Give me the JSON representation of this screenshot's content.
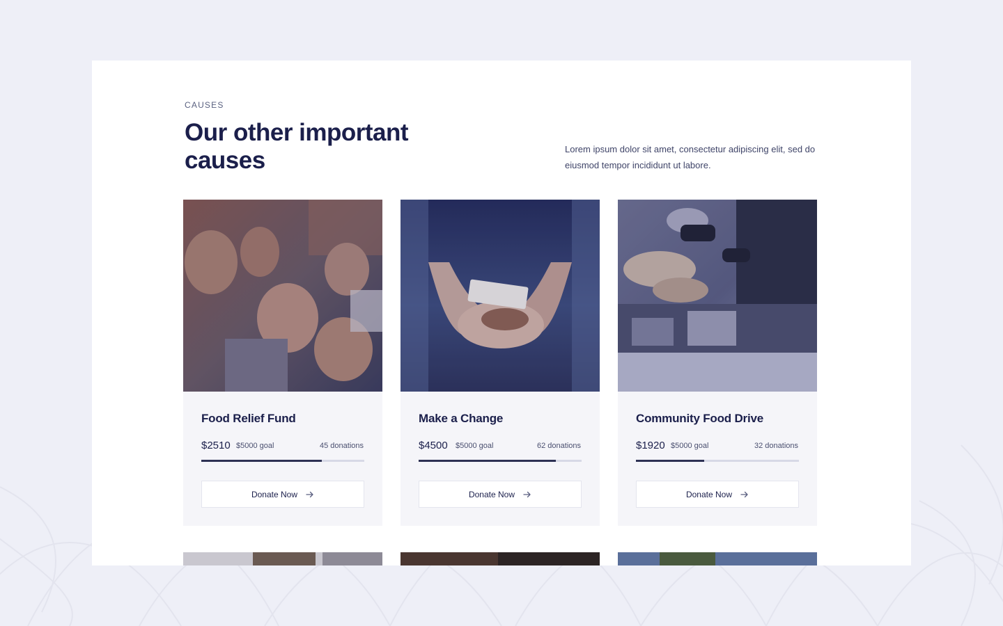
{
  "section": {
    "eyebrow": "CAUSES",
    "title": "Our other important causes",
    "description": "Lorem ipsum dolor sit amet, consectetur adipiscing elit, sed do eiusmod tempor incididunt ut labore."
  },
  "causes": [
    {
      "title": "Food Relief Fund",
      "raised": "$2510",
      "goal": "$5000 goal",
      "donations": "45 donations",
      "progress_fraction": 0.74,
      "button_label": "Donate Now",
      "image": "children-smiling-photo"
    },
    {
      "title": "Make a Change",
      "raised": "$4500",
      "goal": "$5000 goal",
      "donations": "62 donations",
      "progress_fraction": 0.84,
      "button_label": "Donate Now",
      "image": "hands-coins-photo"
    },
    {
      "title": "Community Food Drive",
      "raised": "$1920",
      "goal": "$5000 goal",
      "donations": "32 donations",
      "progress_fraction": 0.42,
      "button_label": "Donate Now",
      "image": "food-distribution-photo"
    }
  ],
  "colors": {
    "page_background": "#eeeff7",
    "panel_background": "#ffffff",
    "card_background": "#f5f5f9",
    "heading": "#1b1f4b",
    "progress_fill": "#2d3154",
    "progress_track": "#d7d9e6"
  }
}
